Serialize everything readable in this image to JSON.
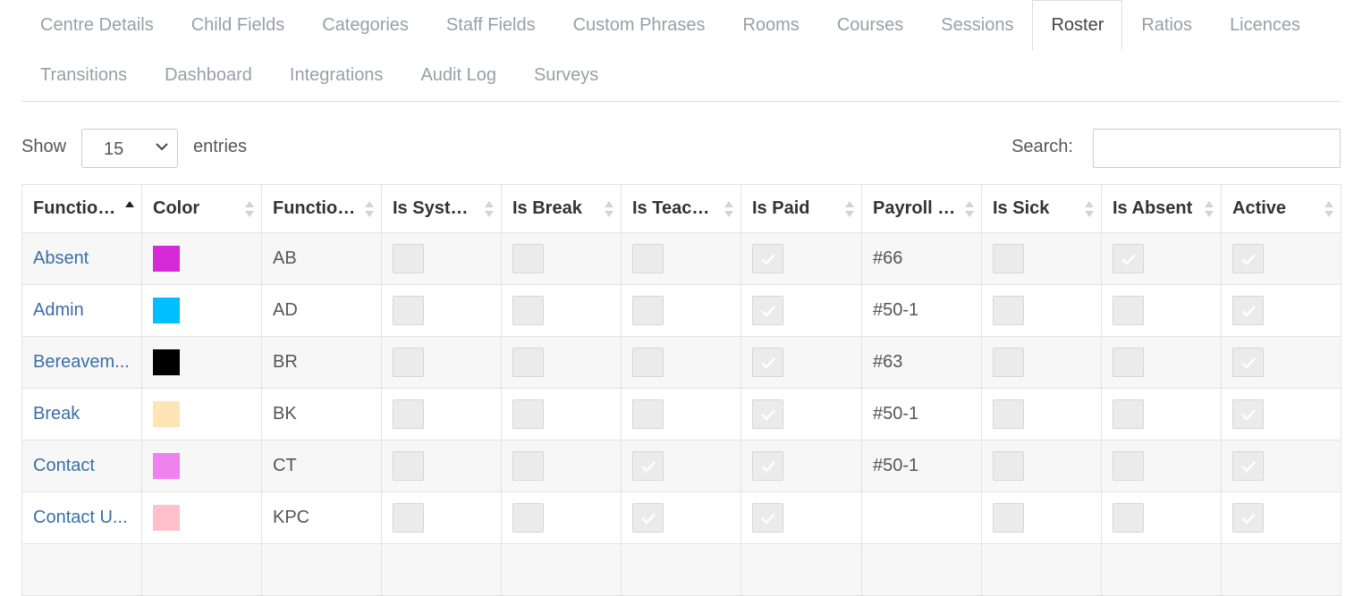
{
  "tabs": {
    "row1": [
      "Centre Details",
      "Child Fields",
      "Categories",
      "Staff Fields",
      "Custom Phrases",
      "Rooms",
      "Courses",
      "Sessions",
      "Roster",
      "Ratios",
      "Licences"
    ],
    "row2": [
      "Transitions",
      "Dashboard",
      "Integrations",
      "Audit Log",
      "Surveys"
    ],
    "active": "Roster"
  },
  "controls": {
    "show_label": "Show",
    "page_size": "15",
    "entries_label": "entries",
    "search_label": "Search:",
    "search_value": ""
  },
  "table": {
    "columns": [
      "Function ...",
      "Color",
      "Function ...",
      "Is System...",
      "Is Break",
      "Is Teaching",
      "Is Paid",
      "Payroll C...",
      "Is Sick",
      "Is Absent",
      "Active"
    ],
    "header_display": [
      "Function ...",
      "Color",
      "Function ...",
      "Is System...",
      "Is Break",
      "Is Teaching",
      "Is Paid",
      "Payroll C...",
      "Is Sick",
      "Is Absent",
      "Active"
    ],
    "rows": [
      {
        "function": "Absent",
        "color": "#d62ad6",
        "code": "AB",
        "is_system": false,
        "is_break": false,
        "is_teaching": false,
        "is_paid": true,
        "payroll": "#66",
        "is_sick": false,
        "is_absent": true,
        "active": true
      },
      {
        "function": "Admin",
        "color": "#00bfff",
        "code": "AD",
        "is_system": false,
        "is_break": false,
        "is_teaching": false,
        "is_paid": true,
        "payroll": "#50-1",
        "is_sick": false,
        "is_absent": false,
        "active": true
      },
      {
        "function": "Bereavem...",
        "color": "#000000",
        "code": "BR",
        "is_system": false,
        "is_break": false,
        "is_teaching": false,
        "is_paid": true,
        "payroll": "#63",
        "is_sick": false,
        "is_absent": false,
        "active": true
      },
      {
        "function": "Break",
        "color": "#ffe4b5",
        "code": "BK",
        "is_system": false,
        "is_break": false,
        "is_teaching": false,
        "is_paid": true,
        "payroll": "#50-1",
        "is_sick": false,
        "is_absent": false,
        "active": true
      },
      {
        "function": "Contact",
        "color": "#ee82ee",
        "code": "CT",
        "is_system": false,
        "is_break": false,
        "is_teaching": true,
        "is_paid": true,
        "payroll": "#50-1",
        "is_sick": false,
        "is_absent": false,
        "active": true
      },
      {
        "function": "Contact U...",
        "color": "#ffc0cb",
        "code": "KPC",
        "is_system": false,
        "is_break": false,
        "is_teaching": true,
        "is_paid": true,
        "payroll": "",
        "is_sick": false,
        "is_absent": false,
        "active": true
      }
    ]
  }
}
